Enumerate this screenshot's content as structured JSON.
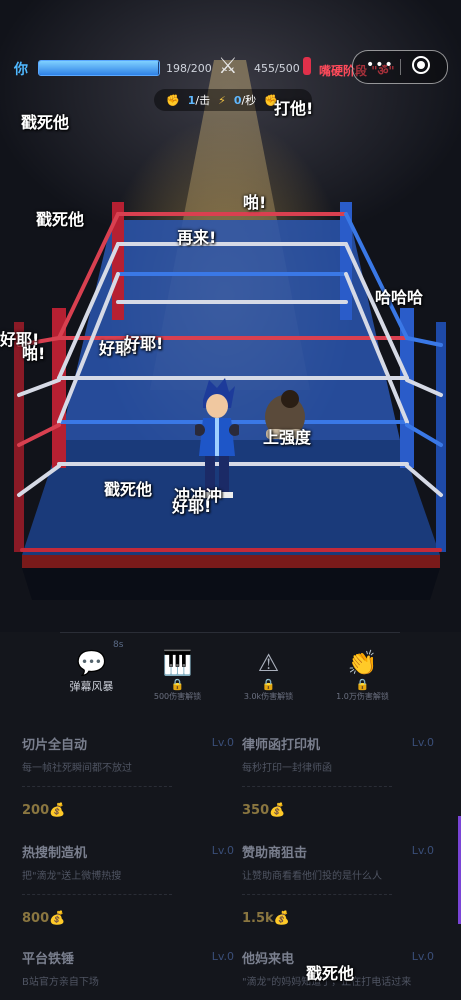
{
  "hud": {
    "player_name": "你",
    "player_hp": "198/200",
    "player_hp_fraction": 0.99,
    "enemy_hp": "455/500",
    "enemy_name": "嘴硬阶段",
    "enemy_tag": "\"ॐ\"",
    "capsule_dots": "•••",
    "stats": {
      "per_hit": "1",
      "per_hit_unit": "/击",
      "per_sec": "0",
      "per_sec_unit": "/秒"
    }
  },
  "danmaku": [
    {
      "text": "戳死他"
    },
    {
      "text": "打他!"
    },
    {
      "text": "啪!"
    },
    {
      "text": "戳死他"
    },
    {
      "text": "再来!"
    },
    {
      "text": "哈哈哈"
    },
    {
      "text": "好耶!"
    },
    {
      "text": "啪!"
    },
    {
      "text": "好耶!"
    },
    {
      "text": "好耶!"
    },
    {
      "text": "上强度"
    },
    {
      "text": "戳死他"
    },
    {
      "text": "冲冲冲"
    },
    {
      "text": "好耶!"
    },
    {
      "text": "戳死他"
    }
  ],
  "skills": [
    {
      "label": "弹幕风暴",
      "icon": "chat-bubble-icon",
      "badge": "8s"
    },
    {
      "label": "",
      "icon": "piano-icon",
      "unlock": "500伤害解锁"
    },
    {
      "label": "",
      "icon": "warning-icon",
      "unlock": "3.0k伤害解锁"
    },
    {
      "label": "",
      "icon": "clap-icon",
      "unlock": "1.0万伤害解锁"
    }
  ],
  "upgrades": [
    {
      "title": "切片全自动",
      "level": "Lv.0",
      "desc": "每一帧社死瞬间都不放过",
      "price": "200"
    },
    {
      "title": "律师函打印机",
      "level": "Lv.0",
      "desc": "每秒打印一封律师函",
      "price": "350"
    },
    {
      "title": "热搜制造机",
      "level": "Lv.0",
      "desc": "把\"滴龙\"送上微博热搜",
      "price": "800"
    },
    {
      "title": "赞助商狙击",
      "level": "Lv.0",
      "desc": "让赞助商看看他们投的是什么人",
      "price": "1.5k"
    },
    {
      "title": "平台铁锤",
      "level": "Lv.0",
      "desc": "B站官方亲自下场",
      "price": ""
    },
    {
      "title": "他妈来电",
      "level": "Lv.0",
      "desc": "\"滴龙\"的妈妈知道了，正在打电话过来",
      "price": ""
    }
  ],
  "colors": {
    "accent_blue": "#4fb8ff",
    "enemy_red": "#ff4a5a",
    "scroll_purple": "#7a44d6"
  }
}
